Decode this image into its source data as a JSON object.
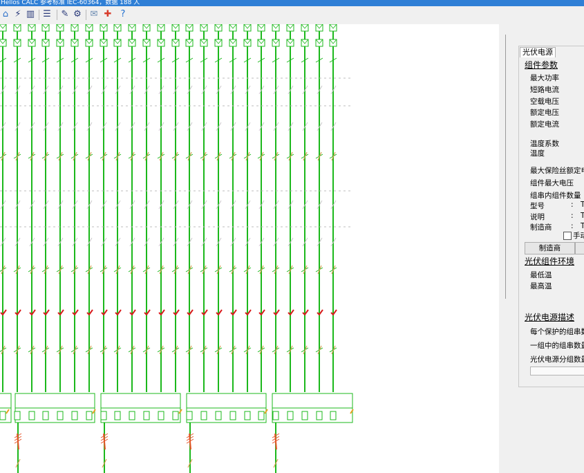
{
  "window": {
    "title": "Hellos CALC 参考标准 IEC-60364，数据 188 人"
  },
  "toolbar": {
    "buttons": [
      {
        "name": "home-icon",
        "glyph": "⌂",
        "color": "#2a6fc9"
      },
      {
        "name": "lightning-icon",
        "glyph": "⚡",
        "color": "#2a3a7a"
      },
      {
        "name": "bar-chart-icon",
        "glyph": "▥",
        "color": "#2a3a7a"
      },
      {
        "name": "database-icon",
        "glyph": "☰",
        "color": "#2a3a7a"
      },
      {
        "name": "wrench-icon",
        "glyph": "✎",
        "color": "#2a3a7a"
      },
      {
        "name": "gear-icon",
        "glyph": "⚙",
        "color": "#2a3a7a"
      },
      {
        "name": "report-icon",
        "glyph": "✉",
        "color": "#6a8ab0"
      },
      {
        "name": "lifebuoy-icon",
        "glyph": "✚",
        "color": "#d83b2b"
      },
      {
        "name": "help-icon",
        "glyph": "?",
        "color": "#1f6fd0"
      }
    ]
  },
  "diagram": {
    "string_count": 24,
    "group_count": 4,
    "line_color": "#1bb81b",
    "check_color": "#d81b1b",
    "fuse_color": "#e8552a"
  },
  "panel": {
    "tab_label": "光伏电源",
    "sections": {
      "module_params": "组件参数",
      "environment": "光伏组件环境",
      "source_desc": "光伏电源描述"
    },
    "fields": {
      "max_power": "最大功率",
      "short_circuit_current": "短路电流",
      "open_circuit_voltage": "空载电压",
      "rated_voltage": "额定电压",
      "rated_current": "额定电流",
      "temp_coefficient": "温度系数",
      "temperature": "温度",
      "max_fuse_rating": "最大保险丝额定电",
      "module_max_voltage": "组件最大电压",
      "modules_per_string": "组串内组件数量",
      "model": "型号",
      "description": "说明",
      "manufacturer": "制造商",
      "min_temp": "最低温",
      "max_temp": "最高温",
      "strings_per_protection": "每个保护的组串数",
      "strings_per_group": "一组中的组串数量",
      "source_groups": "光伏电源分组数量"
    },
    "colon": ":",
    "truncated_value": "T",
    "manual_checkbox_label": "手动",
    "manufacturer_button": "制造商"
  }
}
